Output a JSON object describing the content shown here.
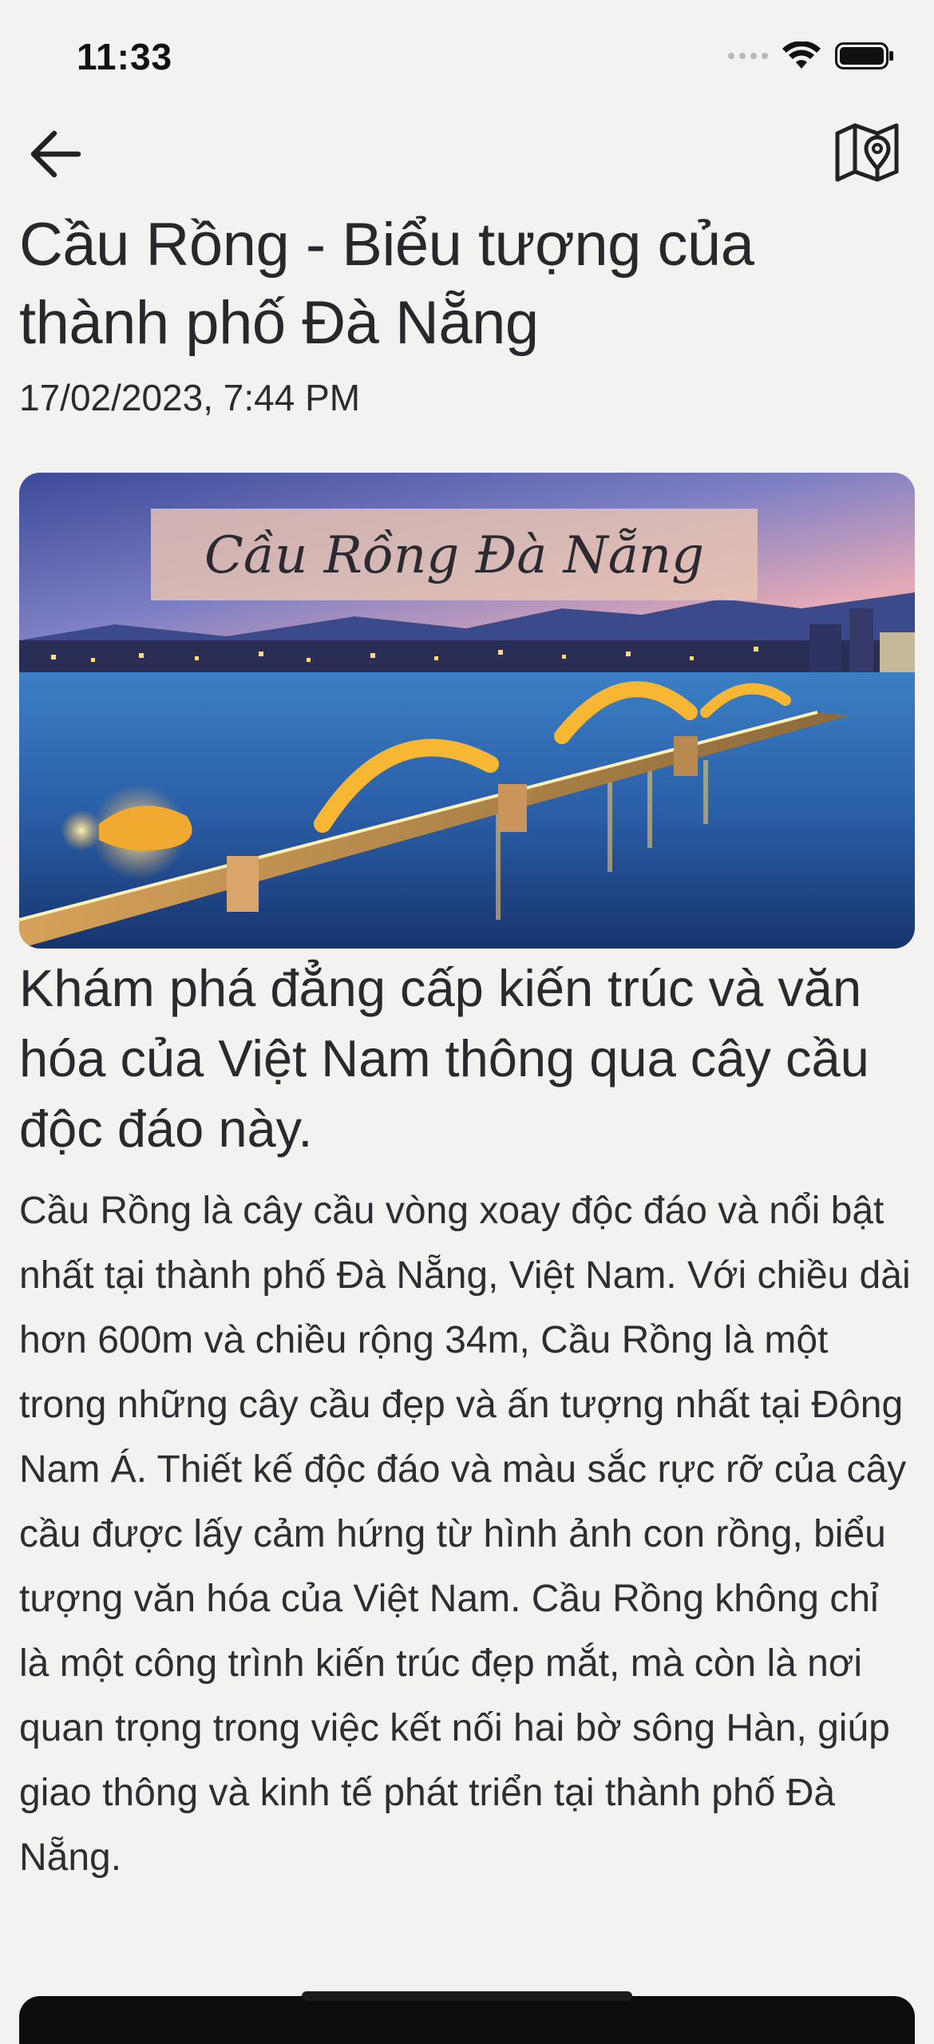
{
  "status_bar": {
    "time": "11:33",
    "icons": [
      "signal-dots-icon",
      "wifi-icon",
      "battery-icon"
    ]
  },
  "nav": {
    "back_icon": "arrow-left-icon",
    "map_icon": "map-pin-icon"
  },
  "article": {
    "title": "Cầu Rồng - Biểu tượng của thành phố Đà Nẵng",
    "date": "17/02/2023, 7:44 PM",
    "image_caption": "Cầu Rồng Đà Nẵng",
    "subtitle": "Khám phá đẳng cấp kiến trúc và văn hóa của Việt Nam thông qua cây cầu độc đáo này.",
    "body": "Cầu Rồng là cây cầu vòng xoay độc đáo và nổi bật nhất tại thành phố Đà Nẵng, Việt Nam. Với chiều dài hơn 600m và chiều rộng 34m, Cầu Rồng là một trong những cây cầu đẹp và ấn tượng nhất tại Đông Nam Á. Thiết kế độc đáo và màu sắc rực rỡ của cây cầu được lấy cảm hứng từ hình ảnh con rồng, biểu tượng văn hóa của Việt Nam. Cầu Rồng không chỉ là một công trình kiến trúc đẹp mắt, mà còn là nơi quan trọng trong việc kết nối hai bờ sông Hàn, giúp giao thông và kinh tế phát triển tại thành phố Đà Nẵng."
  },
  "colors": {
    "background": "#f3f2f1",
    "text": "#28282c"
  }
}
